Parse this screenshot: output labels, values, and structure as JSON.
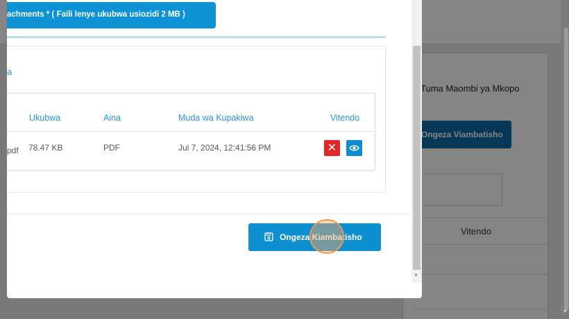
{
  "background": {
    "link_text": "Tuma Maombi ya Mkopo",
    "button_label": "Ongeza Viambatisho",
    "column_header": "Vitendo"
  },
  "modal": {
    "attachments_label": "achments * ( Faili lenye ukubwa usiozidi 2 MB )",
    "card_title": "a",
    "table": {
      "headers": {
        "size": "Ukubwa",
        "type": "Aina",
        "upload_time": "Muda wa Kupakiwa",
        "actions": "Vitendo"
      },
      "rows": [
        {
          "name": "pdf",
          "size": "78.47 KB",
          "type": "PDF",
          "upload_time": "Jul 7, 2024, 12:41:56 PM",
          "delete_icon": "close-icon",
          "view_icon": "eye-icon"
        }
      ]
    },
    "add_button_label": "Ongeza Kiambatisho",
    "add_button_icon": "save-icon"
  },
  "colors": {
    "primary": "#0d8fd0",
    "danger": "#e02828",
    "header_text": "#2a92d6",
    "click_highlight": "#f29a4b"
  }
}
